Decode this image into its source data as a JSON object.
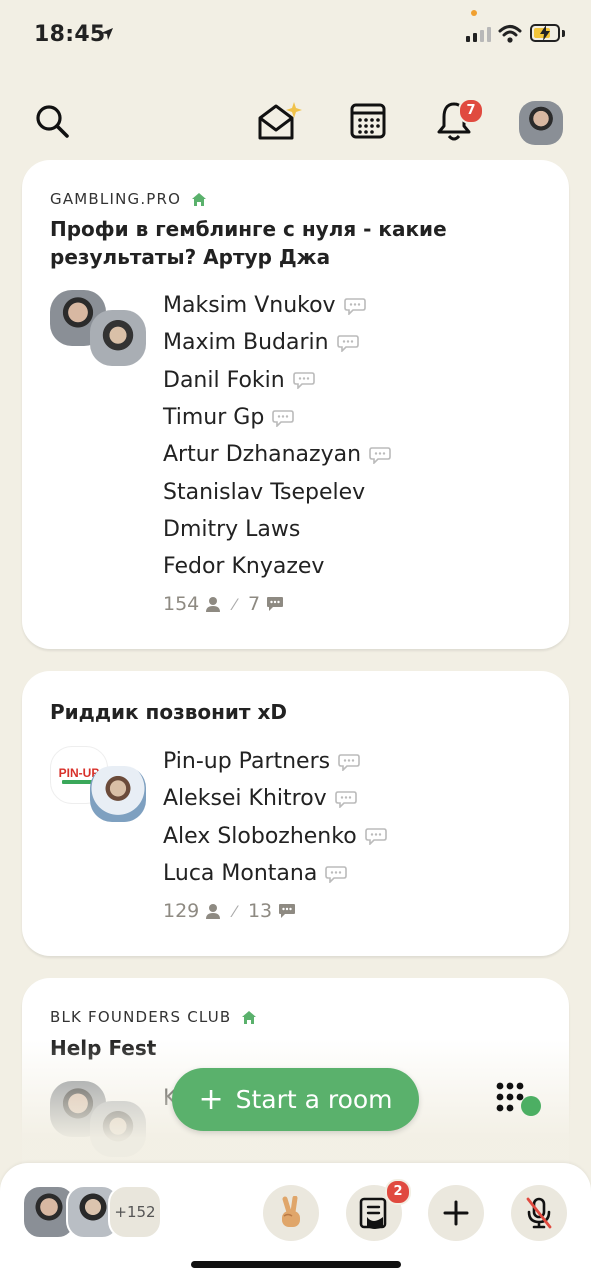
{
  "status_bar": {
    "time": "18:45"
  },
  "top_nav": {
    "notifications_count": "7"
  },
  "rooms": [
    {
      "club": "GAMBLING.PRO",
      "title": "Профи в гемблинге с нуля - какие результаты? Артур Джа",
      "speakers": [
        "Maksim Vnukov",
        "Maxim Budarin",
        "Danil Fokin",
        "Timur Gp",
        "Artur Dzhanazyan",
        "Stanislav Tsepelev",
        "Dmitry Laws",
        "Fedor Knyazev"
      ],
      "speakers_with_bubble": [
        true,
        true,
        true,
        true,
        true,
        false,
        false,
        false
      ],
      "listeners": "154",
      "speaking": "7"
    },
    {
      "club": "",
      "title": "Риддик позвонит xD",
      "speakers": [
        "Pin-up Partners",
        "Aleksei Khitrov",
        "Alex Slobozhenko",
        "Luca Montana"
      ],
      "speakers_with_bubble": [
        true,
        true,
        true,
        true
      ],
      "listeners": "129",
      "speaking": "13",
      "logo_text": "PIN-UP"
    },
    {
      "club": "BLK FOUNDERS CLUB",
      "title": "Help Fest",
      "partial_speaker": "K"
    }
  ],
  "actions": {
    "start_room": "Start a room"
  },
  "bottom_bar": {
    "more_count": "+152",
    "raised_hands_count": "2"
  },
  "colors": {
    "accent_green": "#5ab16c",
    "badge_red": "#e04a3f",
    "background": "#f2efe4"
  },
  "icons": [
    "search-icon",
    "invite-envelope-icon",
    "calendar-icon",
    "bell-icon",
    "peace-hand-icon",
    "raised-hands-icon",
    "plus-icon",
    "mic-off-icon",
    "dots-grid-icon",
    "house-icon",
    "chat-bubble-icon",
    "person-icon"
  ]
}
